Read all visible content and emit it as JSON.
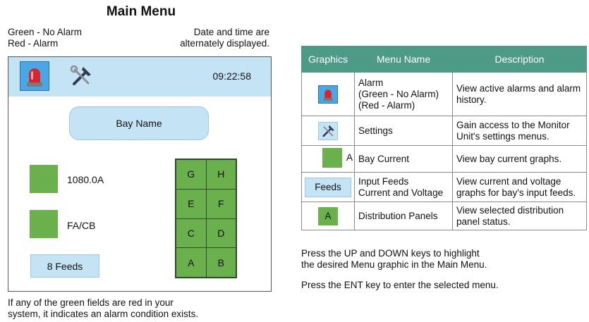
{
  "main_menu": {
    "title": "Main Menu",
    "note_left_1": "Green - No Alarm",
    "note_left_2": "Red - Alarm",
    "note_right_1": "Date and time are",
    "note_right_2": "alternately displayed.",
    "time": "09:22:58",
    "bay_name": "Bay Name",
    "current_value": "1080.0A",
    "fa_cb": "FA/CB",
    "feeds": "8 Feeds",
    "panels": [
      "G",
      "H",
      "E",
      "F",
      "C",
      "D",
      "A",
      "B"
    ],
    "footer_1": "If any of the green fields are red in your",
    "footer_2": "system, it indicates an alarm condition exists."
  },
  "table": {
    "headers": [
      "Graphics",
      "Menu Name",
      "Description"
    ],
    "rows": [
      {
        "menu_lines": [
          "Alarm",
          "(Green - No Alarm)",
          "(Red - Alarm)"
        ],
        "description": "View active alarms and alarm history."
      },
      {
        "menu_lines": [
          "Settings"
        ],
        "description": "Gain access to the Monitor Unit's settings menus."
      },
      {
        "graphic_text": "A",
        "menu_lines": [
          "Bay Current"
        ],
        "description": "View bay current graphs."
      },
      {
        "graphic_text": "Feeds",
        "menu_lines": [
          "Input Feeds",
          "Current and Voltage"
        ],
        "description": "View current and voltage graphs for bay's input feeds."
      },
      {
        "graphic_text": "A",
        "menu_lines": [
          "Distribution Panels"
        ],
        "description": "View selected distribution panel status."
      }
    ]
  },
  "instructions": {
    "line1": "Press the UP and DOWN keys to highlight",
    "line2": "the desired Menu graphic in the Main Menu.",
    "line3": "Press the ENT key to enter the selected menu."
  },
  "colors": {
    "green": "#6ab04c",
    "light_blue": "#c4e4f6",
    "header_teal": "#4d9a86",
    "alarm_red": "#d9262c"
  },
  "icons": [
    "alarm-beacon-icon",
    "settings-tools-icon"
  ]
}
